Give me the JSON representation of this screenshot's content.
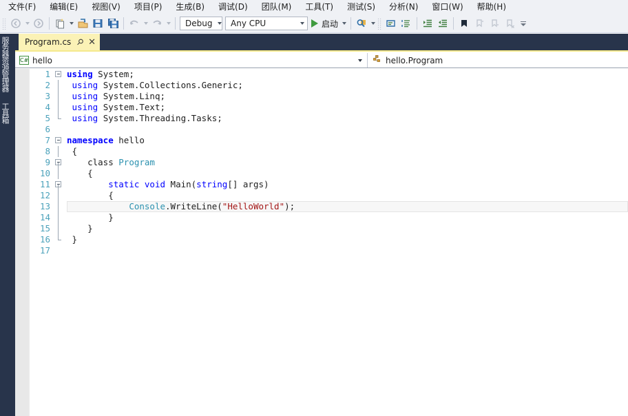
{
  "menubar": {
    "items": [
      {
        "label": "文件(F)",
        "name": "menu-file"
      },
      {
        "label": "编辑(E)",
        "name": "menu-edit"
      },
      {
        "label": "视图(V)",
        "name": "menu-view"
      },
      {
        "label": "项目(P)",
        "name": "menu-project"
      },
      {
        "label": "生成(B)",
        "name": "menu-build"
      },
      {
        "label": "调试(D)",
        "name": "menu-debug"
      },
      {
        "label": "团队(M)",
        "name": "menu-team"
      },
      {
        "label": "工具(T)",
        "name": "menu-tools"
      },
      {
        "label": "测试(S)",
        "name": "menu-test"
      },
      {
        "label": "分析(N)",
        "name": "menu-analyze"
      },
      {
        "label": "窗口(W)",
        "name": "menu-window"
      },
      {
        "label": "帮助(H)",
        "name": "menu-help"
      }
    ]
  },
  "toolbar": {
    "configuration": "Debug",
    "platform": "Any CPU",
    "start_label": "启动",
    "icons": [
      "navigate-back-icon",
      "navigate-forward-icon",
      "new-project-icon",
      "open-file-icon",
      "save-icon",
      "save-all-icon",
      "undo-icon",
      "redo-icon",
      "find-icon",
      "toggle-bookmark-icon",
      "comment-icon",
      "uncomment-icon",
      "indent-icon",
      "outdent-icon",
      "bookmark-icon",
      "prev-bookmark-icon",
      "next-bookmark-icon",
      "clear-bookmarks-icon"
    ]
  },
  "leftdock": {
    "server_explorer": "服务器资源管理器",
    "toolbox": "工具箱"
  },
  "tabs": [
    {
      "title": "Program.cs",
      "pin": "⚲",
      "close": "✕"
    }
  ],
  "navbar": {
    "type_label": "hello",
    "type_icon": "csharp-file-icon",
    "member_label": "hello.Program",
    "member_icon": "class-member-icon"
  },
  "editor": {
    "lines": [
      {
        "num": "1",
        "fold": "box",
        "tokens": [
          {
            "t": "using",
            "c": "kw-b"
          },
          {
            "t": " System;",
            "c": "plain"
          }
        ]
      },
      {
        "num": "2",
        "fold": "line",
        "tokens": [
          {
            "t": " ",
            "c": "plain"
          },
          {
            "t": "using",
            "c": "kw"
          },
          {
            "t": " System.Collections.Generic;",
            "c": "plain"
          }
        ]
      },
      {
        "num": "3",
        "fold": "line",
        "tokens": [
          {
            "t": " ",
            "c": "plain"
          },
          {
            "t": "using",
            "c": "kw"
          },
          {
            "t": " System.Linq;",
            "c": "plain"
          }
        ]
      },
      {
        "num": "4",
        "fold": "line",
        "tokens": [
          {
            "t": " ",
            "c": "plain"
          },
          {
            "t": "using",
            "c": "kw"
          },
          {
            "t": " System.Text;",
            "c": "plain"
          }
        ]
      },
      {
        "num": "5",
        "fold": "end",
        "tokens": [
          {
            "t": " ",
            "c": "plain"
          },
          {
            "t": "using",
            "c": "kw"
          },
          {
            "t": " System.Threading.Tasks;",
            "c": "plain"
          }
        ]
      },
      {
        "num": "6",
        "fold": "none",
        "tokens": []
      },
      {
        "num": "7",
        "fold": "box",
        "tokens": [
          {
            "t": "namespace",
            "c": "kw-b"
          },
          {
            "t": " hello",
            "c": "plain"
          }
        ]
      },
      {
        "num": "8",
        "fold": "line",
        "tokens": [
          {
            "t": " {",
            "c": "plain"
          }
        ]
      },
      {
        "num": "9",
        "fold": "box-line",
        "tokens": [
          {
            "t": "    class ",
            "c": "plain"
          },
          {
            "t": "Program",
            "c": "type"
          }
        ]
      },
      {
        "num": "10",
        "fold": "line",
        "tokens": [
          {
            "t": "    {",
            "c": "plain"
          }
        ]
      },
      {
        "num": "11",
        "fold": "box-line",
        "tokens": [
          {
            "t": "        ",
            "c": "plain"
          },
          {
            "t": "static",
            "c": "kw"
          },
          {
            "t": " ",
            "c": "plain"
          },
          {
            "t": "void",
            "c": "kw"
          },
          {
            "t": " Main(",
            "c": "plain"
          },
          {
            "t": "string",
            "c": "kw"
          },
          {
            "t": "[] args)",
            "c": "plain"
          }
        ]
      },
      {
        "num": "12",
        "fold": "line",
        "tokens": [
          {
            "t": "        {",
            "c": "plain"
          }
        ]
      },
      {
        "num": "13",
        "fold": "line",
        "tokens": [
          {
            "t": "            ",
            "c": "plain"
          },
          {
            "t": "Console",
            "c": "type"
          },
          {
            "t": ".WriteLine(",
            "c": "plain"
          },
          {
            "t": "\"HelloWorld\"",
            "c": "str"
          },
          {
            "t": ");",
            "c": "plain"
          }
        ],
        "current": true
      },
      {
        "num": "14",
        "fold": "line",
        "tokens": [
          {
            "t": "        }",
            "c": "plain"
          }
        ]
      },
      {
        "num": "15",
        "fold": "line",
        "tokens": [
          {
            "t": "    }",
            "c": "plain"
          }
        ]
      },
      {
        "num": "16",
        "fold": "end",
        "tokens": [
          {
            "t": " }",
            "c": "plain"
          }
        ]
      },
      {
        "num": "17",
        "fold": "none",
        "tokens": []
      }
    ]
  }
}
